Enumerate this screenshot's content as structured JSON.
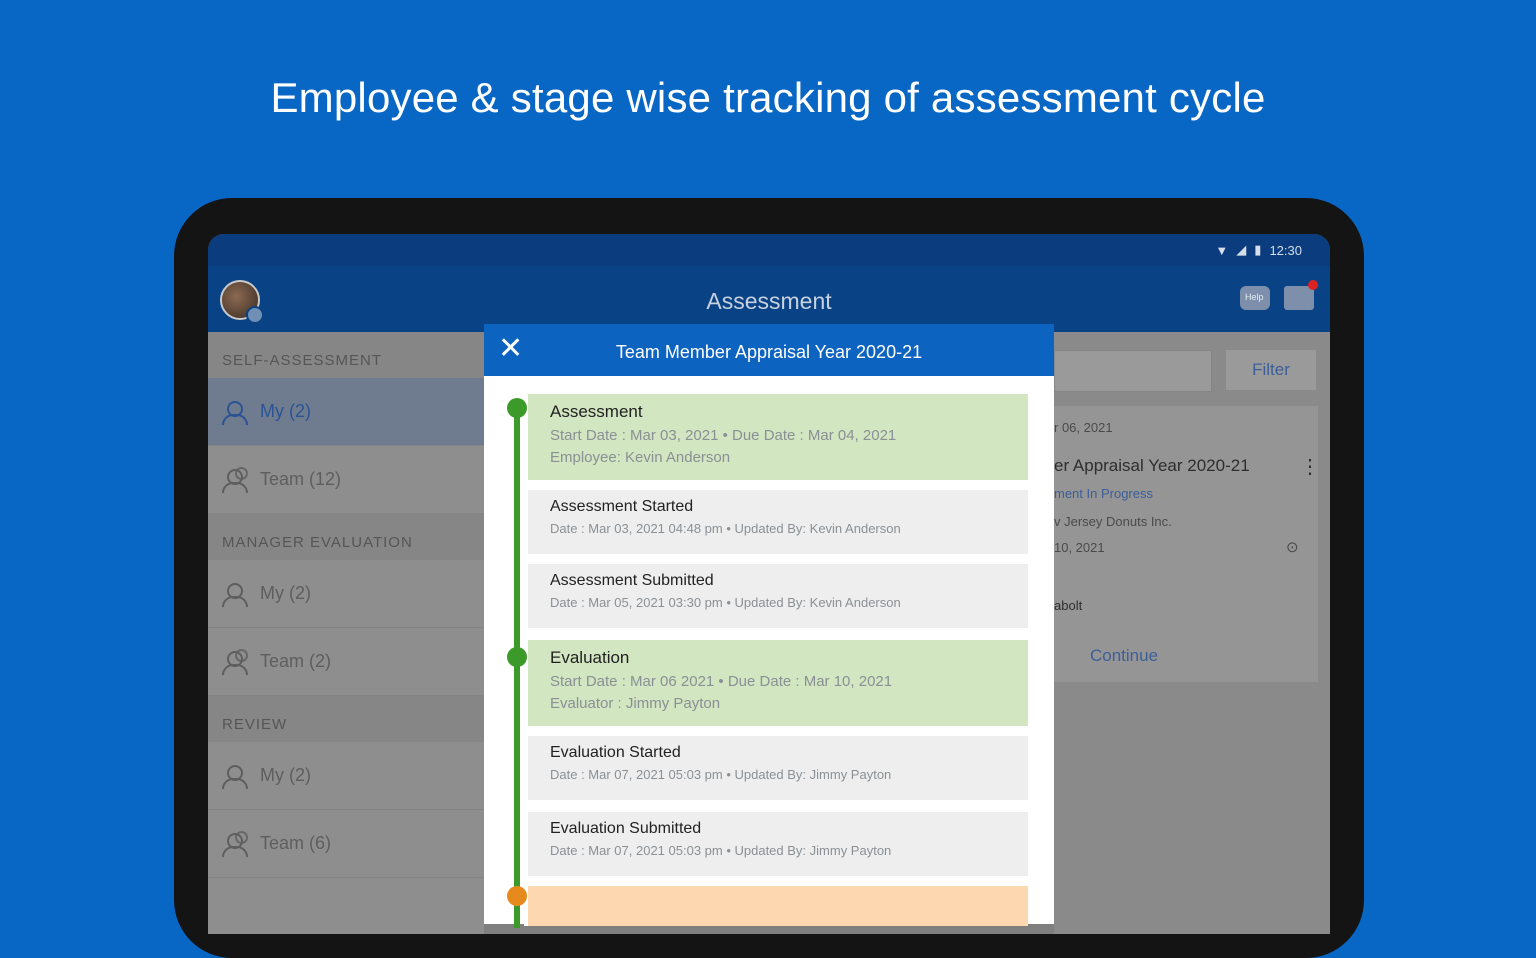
{
  "headline": "Employee & stage wise tracking of assessment cycle",
  "status_bar": {
    "time": "12:30"
  },
  "app_bar": {
    "title": "Assessment"
  },
  "sidebar": {
    "sections": [
      {
        "header": "SELF-ASSESSMENT",
        "items": [
          {
            "label": "My (2)"
          },
          {
            "label": "Team (12)"
          }
        ]
      },
      {
        "header": "MANAGER EVALUATION",
        "items": [
          {
            "label": "My (2)"
          },
          {
            "label": "Team (2)"
          }
        ]
      },
      {
        "header": "REVIEW",
        "items": [
          {
            "label": "My (2)"
          },
          {
            "label": "Team (6)"
          }
        ]
      }
    ]
  },
  "right_panel": {
    "filter_label": "Filter",
    "date": "r 06, 2021",
    "card_title": "er Appraisal Year 2020-21",
    "status": "ment In Progress",
    "company": "v Jersey Donuts Inc.",
    "due": "10, 2021",
    "person": "abolt",
    "continue_label": "Continue"
  },
  "modal": {
    "title": "Team Member Appraisal Year 2020-21",
    "close_icon": "close-icon",
    "timeline": [
      {
        "kind": "stage",
        "title": "Assessment",
        "line1": "Start Date : Mar 03, 2021 • Due Date : Mar 04, 2021",
        "line2": "Employee: Kevin Anderson"
      },
      {
        "kind": "event",
        "title": "Assessment Started",
        "line1": "Date : Mar 03, 2021 04:48 pm • Updated By: Kevin Anderson"
      },
      {
        "kind": "event",
        "title": "Assessment Submitted",
        "line1": "Date : Mar 05, 2021 03:30 pm • Updated By: Kevin Anderson"
      },
      {
        "kind": "stage",
        "title": "Evaluation",
        "line1": "Start Date : Mar 06 2021 • Due Date : Mar 10, 2021",
        "line2": "Evaluator : Jimmy Payton"
      },
      {
        "kind": "event",
        "title": "Evaluation Started",
        "line1": "Date : Mar 07, 2021 05:03 pm • Updated By: Jimmy Payton"
      },
      {
        "kind": "event",
        "title": "Evaluation Submitted",
        "line1": "Date : Mar 07, 2021 05:03 pm • Updated By: Jimmy Payton"
      }
    ]
  },
  "colors": {
    "background": "#0866c4",
    "accent": "#0d63c0",
    "stage_done": "#3c9a2a",
    "stage_pending": "#e68a1e"
  }
}
